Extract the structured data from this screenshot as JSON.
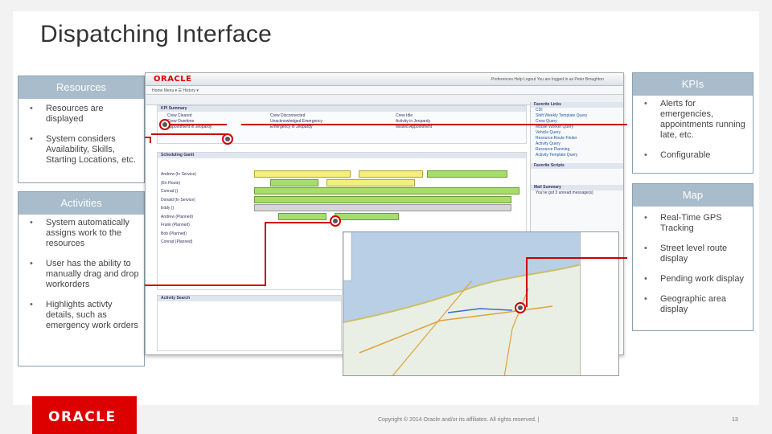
{
  "slide": {
    "title": "Dispatching Interface",
    "footer": {
      "logo_text": "ORACLE",
      "copyright": "Copyright © 2014 Oracle and/or its affiliates. All rights reserved.  |",
      "page_number": "13"
    }
  },
  "panels": {
    "resources": {
      "heading": "Resources",
      "bullets": [
        "Resources are displayed",
        "System considers Availability, Skills, Starting Locations, etc."
      ]
    },
    "activities": {
      "heading": "Activities",
      "bullets": [
        "System automatically assigns work to the resources",
        "User has the ability to manually drag and drop workorders",
        "Highlights activty details, such as emergency work orders"
      ]
    },
    "kpis": {
      "heading": "KPIs",
      "bullets": [
        "Alerts for emergencies, appointments running late, etc.",
        "Configurable"
      ]
    },
    "map": {
      "heading": "Map",
      "bullets": [
        "Real-Time GPS Tracking",
        "Street level route display",
        "Pending work display",
        "Geographic area display"
      ]
    }
  },
  "screenshot": {
    "logo": "ORACLE",
    "menu": "Home   Menu ▾   ☰   History ▾",
    "top_right": "Preferences   Help   Logout   You are logged in as Peter Broughton",
    "kpi_title": "KPI Summary",
    "kpi_items": [
      "Crew Cleared",
      "Crew Overtime",
      "Appointment in Jeopardy",
      "Crew Disconnected",
      "Unacknowledged Emergency",
      "Emergency in Jeopardy",
      "Crew Idle",
      "Activity in Jeopardy",
      "Missed Appointment"
    ],
    "scheduling_title": "Scheduling Gantt",
    "crew_names": [
      "Andrew (In Service)",
      "",
      "(En Route)",
      "Conrad ()",
      "Donald (In Service)",
      "Eddy ()",
      "Andrew (Planned)",
      "Frank (Planned)",
      "Bob (Planned)",
      "Conrad (Planned)"
    ],
    "activity_search": "Activity Search",
    "favorite_links_title": "Favorite Links",
    "favorite_links": [
      "CDI",
      "Shift Weekly Template Query",
      "Crew Query",
      "Mobile Worker Query",
      "Vehicle Query",
      "Resource Route Finder",
      "Activity Query",
      "Resource Planning",
      "Activity Template Query"
    ],
    "favorite_scripts_title": "Favorite Scripts",
    "mail_summary_title": "Mail Summary",
    "mail_text": "You've got 3 unread message(s)"
  },
  "colors": {
    "panel_header": "#a8bccb",
    "accent_red": "#cc0000",
    "gantt_green": "#a6dd6b",
    "gantt_yellow": "#f3ef7a"
  }
}
